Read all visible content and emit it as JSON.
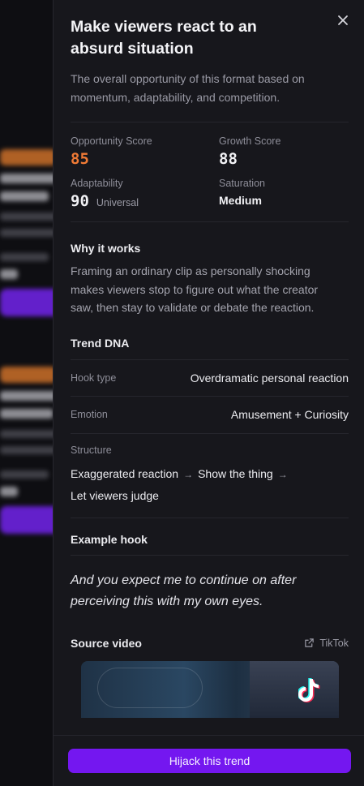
{
  "panel": {
    "title": "Make viewers react to an absurd situation",
    "subtitle": "The overall opportunity of this format based on momentum, adaptability, and competition.",
    "scores": {
      "opportunity_label": "Opportunity Score",
      "opportunity_value": "85",
      "growth_label": "Growth Score",
      "growth_value": "88",
      "adaptability_label": "Adaptability",
      "adaptability_value": "90",
      "adaptability_sub": "Universal",
      "saturation_label": "Saturation",
      "saturation_value": "Medium"
    },
    "why": {
      "heading": "Why it works",
      "body": "Framing an ordinary clip as personally shocking makes viewers stop to figure out what the creator saw, then stay to validate or debate the reaction."
    },
    "dna": {
      "heading": "Trend DNA",
      "hook_label": "Hook type",
      "hook_value": "Overdramatic personal reaction",
      "emotion_label": "Emotion",
      "emotion_value": "Amusement + Curiosity",
      "structure_label": "Structure",
      "structure_steps": [
        "Exaggerated reaction",
        "Show the thing",
        "Let viewers judge"
      ]
    },
    "example": {
      "heading": "Example hook",
      "quote": "And you expect me to continue on after perceiving this with my own eyes."
    },
    "source": {
      "heading": "Source video",
      "platform": "TikTok"
    },
    "cta_label": "Hijack this trend"
  },
  "colors": {
    "accent_purple": "#7417f0",
    "score_orange": "#f07a35",
    "panel_bg": "#17171c"
  },
  "icons": [
    "close-icon",
    "arrow-right-icon",
    "external-link-icon",
    "tiktok-logo-icon"
  ]
}
